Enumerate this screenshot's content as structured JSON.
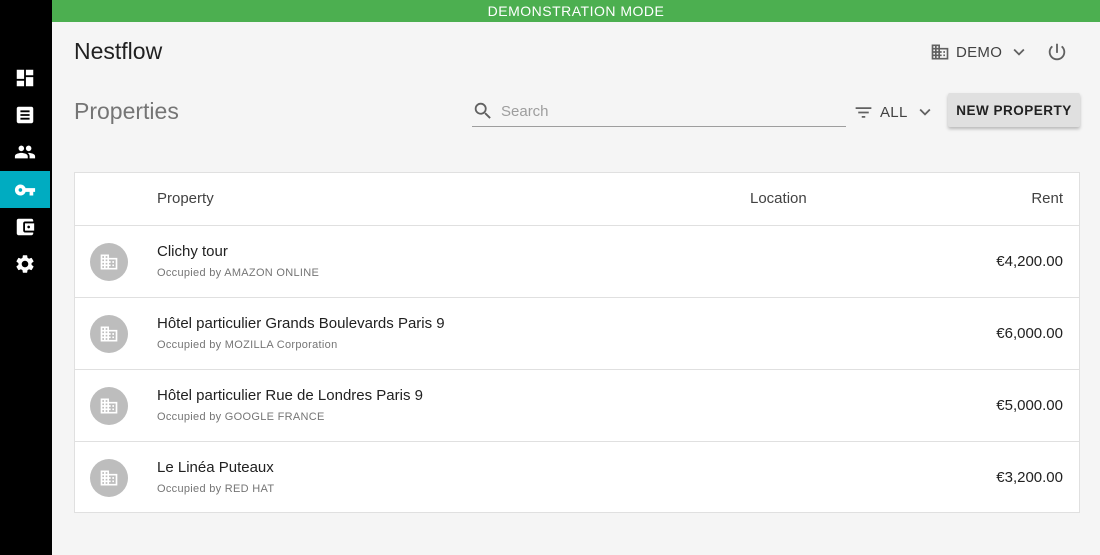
{
  "banner": {
    "text": "DEMONSTRATION MODE"
  },
  "app": {
    "title": "Nestflow"
  },
  "sidebar": {
    "items": [
      {
        "icon": "dashboard-icon",
        "active": false
      },
      {
        "icon": "document-icon",
        "active": false
      },
      {
        "icon": "people-icon",
        "active": false
      },
      {
        "icon": "key-icon",
        "active": true
      },
      {
        "icon": "wallet-icon",
        "active": false
      },
      {
        "icon": "gear-icon",
        "active": false
      }
    ]
  },
  "header": {
    "org_label": "DEMO"
  },
  "page": {
    "title": "Properties"
  },
  "search": {
    "placeholder": "Search",
    "value": ""
  },
  "filter": {
    "label": "ALL"
  },
  "actions": {
    "new_property_label": "NEW PROPERTY"
  },
  "table": {
    "columns": {
      "property": "Property",
      "location": "Location",
      "rent": "Rent"
    },
    "rows": [
      {
        "name": "Clichy tour",
        "occupant": "Occupied by AMAZON ONLINE",
        "location": "",
        "rent": "€4,200.00"
      },
      {
        "name": "Hôtel particulier Grands Boulevards Paris 9",
        "occupant": "Occupied by MOZILLA Corporation",
        "location": "",
        "rent": "€6,000.00"
      },
      {
        "name": "Hôtel particulier Rue de Londres Paris 9",
        "occupant": "Occupied by GOOGLE FRANCE",
        "location": "",
        "rent": "€5,000.00"
      },
      {
        "name": "Le Linéa Puteaux",
        "occupant": "Occupied by RED HAT",
        "location": "",
        "rent": "€3,200.00"
      }
    ]
  },
  "colors": {
    "banner": "#4caf50",
    "sidebar": "#000000",
    "active_nav": "#00acc1",
    "background": "#f5f5f5"
  }
}
